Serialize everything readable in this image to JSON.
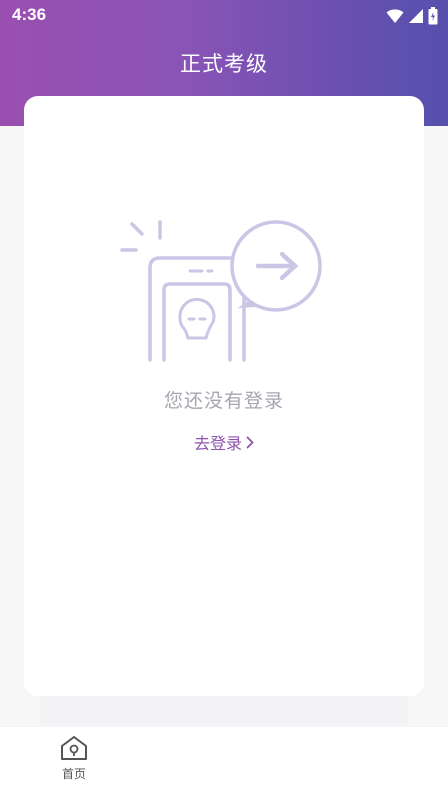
{
  "status_bar": {
    "time": "4:36",
    "icons": [
      "wifi-icon",
      "signal-icon",
      "battery-icon"
    ]
  },
  "header": {
    "title": "正式考级"
  },
  "empty_state": {
    "illustration": "phone-login-illustration",
    "message": "您还没有登录",
    "login_link": "去登录",
    "login_link_icon": "chevron-right-icon"
  },
  "bottom_nav": {
    "items": [
      {
        "label": "首页",
        "icon": "home-icon"
      }
    ]
  },
  "colors": {
    "header_gradient_start": "#9a4fb0",
    "header_gradient_end": "#5650ad",
    "accent": "#8d53ad",
    "illustration_stroke": "#c9c6e6"
  }
}
